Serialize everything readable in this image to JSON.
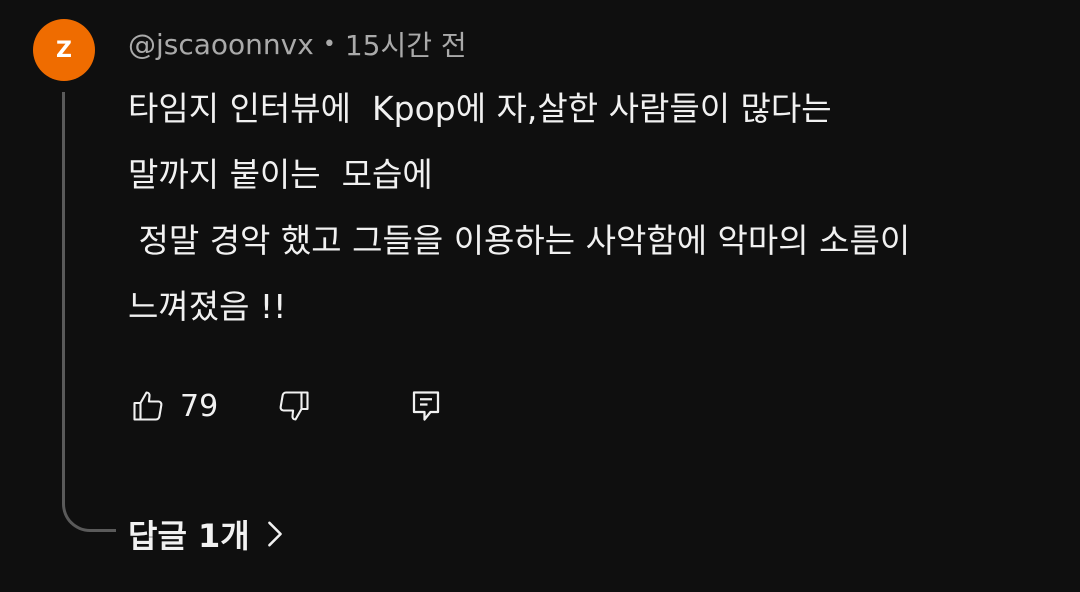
{
  "comment": {
    "avatar_letter": "Z",
    "avatar_color": "#ef6c00",
    "author": "@jscaoonnvx",
    "separator": "•",
    "timestamp": "15시간 전",
    "lines": [
      "타임지 인터뷰에  Kpop에 자,살한 사람들이 많다는",
      "말까지 붙이는  모습에",
      " 정말 경악 했고 그들을 이용하는 사악함에 악마의 소름이",
      "느껴졌음 !!"
    ],
    "like_count": "79",
    "icons": {
      "like": "thumbs-up-icon",
      "dislike": "thumbs-down-icon",
      "reply": "comment-icon",
      "replies_chevron": "chevron-right-icon"
    },
    "replies_label": "답글 1개"
  }
}
